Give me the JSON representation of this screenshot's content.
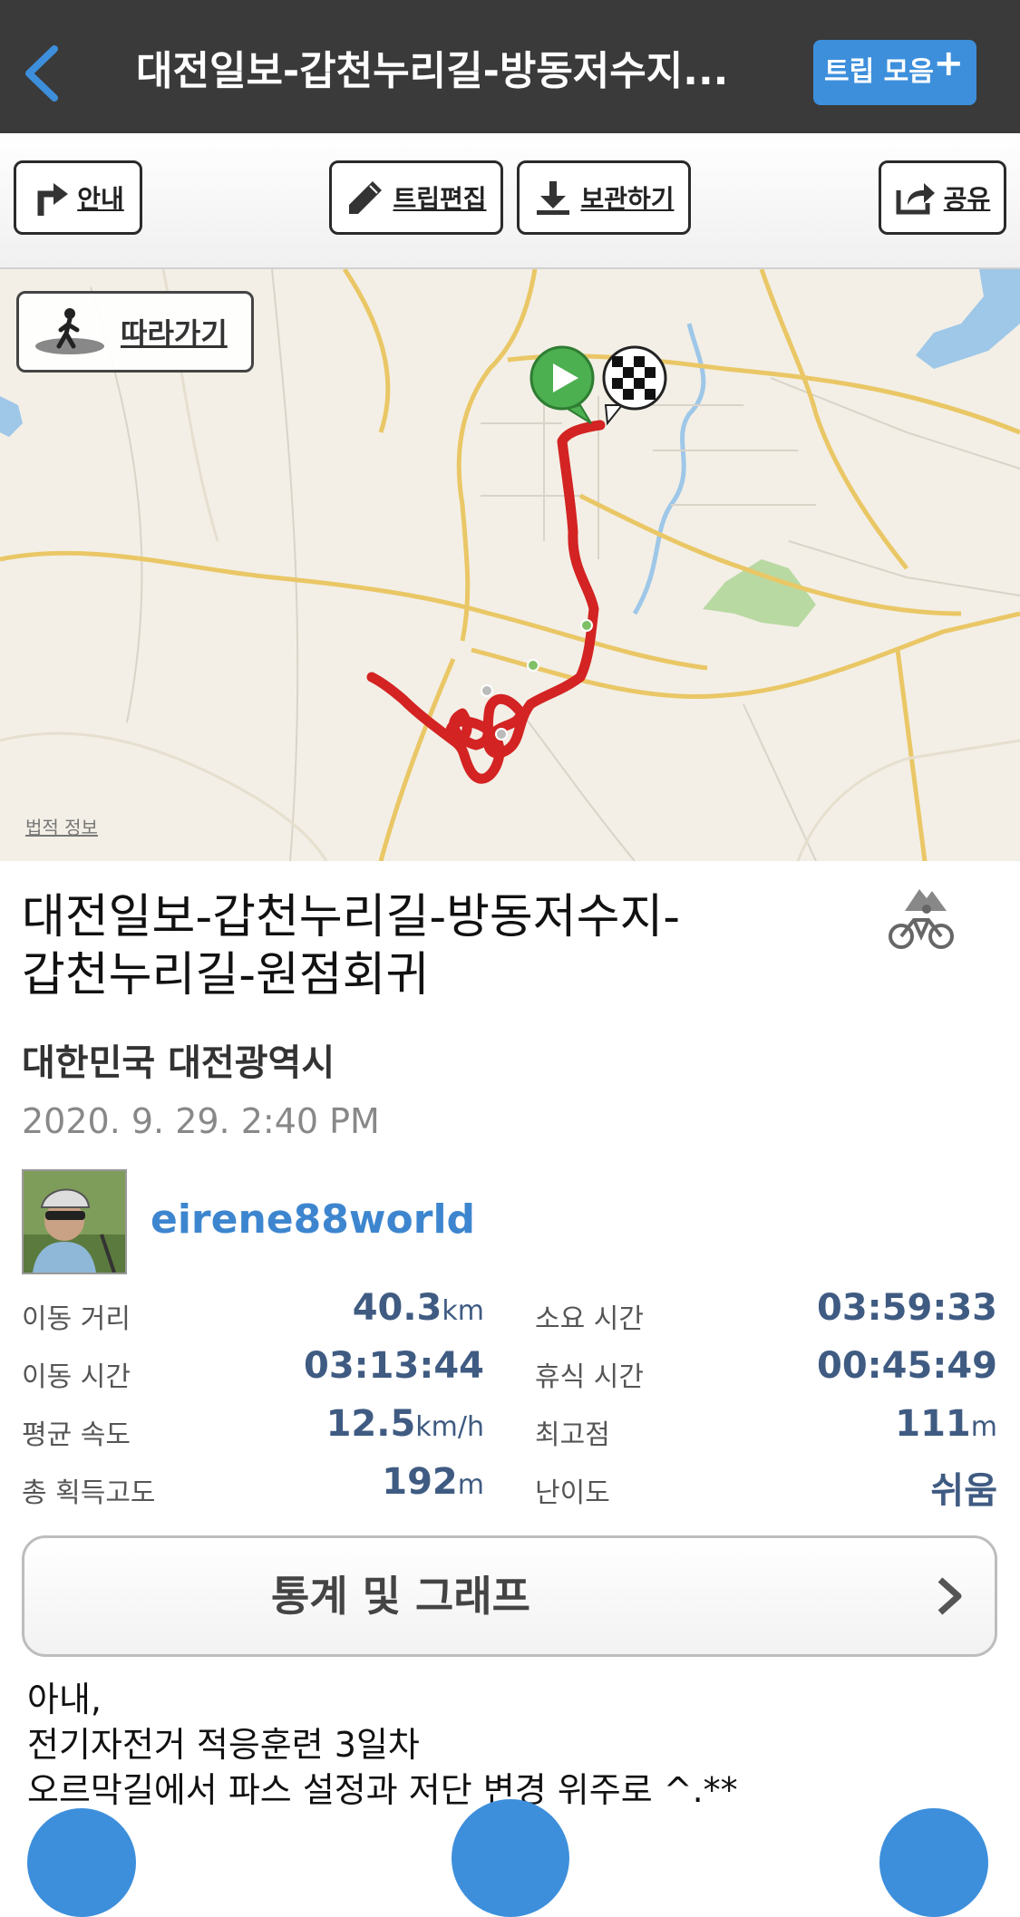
{
  "header": {
    "back_icon": "chevron-left-icon",
    "title": "대전일보-갑천누리길-방동저수지...",
    "trip_collection_label": "트립 모음",
    "trip_collection_icon": "plus-icon"
  },
  "toolbar": {
    "guide_label": "안내",
    "edit_label": "트립편집",
    "save_label": "보관하기",
    "share_label": "공유"
  },
  "map": {
    "follow_label": "따라가기",
    "legal_label": "법적 정보",
    "route_color": "#d32323"
  },
  "trip": {
    "title_line1": "대전일보-갑천누리길-방동저수지-",
    "title_line2": "갑천누리길-원점회귀",
    "activity_icon": "mountain-bike-icon",
    "location": "대한민국 대전광역시",
    "date": "2020. 9. 29. 2:40 PM",
    "username": "eirene88world"
  },
  "stats": {
    "distance_label": "이동 거리",
    "distance_value": "40.3",
    "distance_unit": "km",
    "total_time_label": "소요 시간",
    "total_time_value": "03:59:33",
    "moving_time_label": "이동 시간",
    "moving_time_value": "03:13:44",
    "rest_time_label": "휴식 시간",
    "rest_time_value": "00:45:49",
    "avg_speed_label": "평균 속도",
    "avg_speed_value": "12.5",
    "avg_speed_unit": "km/h",
    "max_alt_label": "최고점",
    "max_alt_value": "111",
    "max_alt_unit": "m",
    "elev_gain_label": "총 획득고도",
    "elev_gain_value": "192",
    "elev_gain_unit": "m",
    "difficulty_label": "난이도",
    "difficulty_value": "쉬움"
  },
  "stats_button_label": "통계 및 그래프",
  "description": {
    "line1": "아내,",
    "line2": "전기자전거 적응훈련 3일차",
    "line3": "오르막길에서 파스 설정과 저단 변경 위주로 ^.**"
  },
  "colors": {
    "header_bg": "#3a3a3a",
    "accent": "#3d8fdc",
    "stat_value": "#3f5b82",
    "username": "#3d86cf"
  }
}
